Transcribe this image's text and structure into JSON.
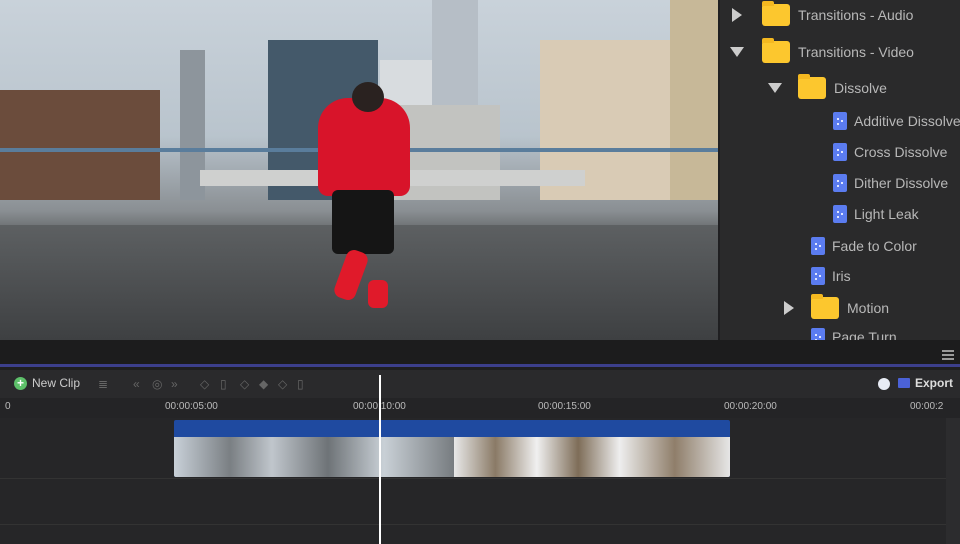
{
  "browser": {
    "items": [
      {
        "label": "Transitions - Audio",
        "type": "folder",
        "expanded": false
      },
      {
        "label": "Transitions - Video",
        "type": "folder",
        "expanded": true
      },
      {
        "label": "Dissolve",
        "type": "folder",
        "expanded": true
      },
      {
        "label": "Additive Dissolve",
        "type": "file"
      },
      {
        "label": "Cross Dissolve",
        "type": "file"
      },
      {
        "label": "Dither Dissolve",
        "type": "file"
      },
      {
        "label": "Light Leak",
        "type": "file"
      },
      {
        "label": "Fade to Color",
        "type": "file"
      },
      {
        "label": "Iris",
        "type": "file"
      },
      {
        "label": "Motion",
        "type": "folder",
        "expanded": false
      },
      {
        "label": "Page Turn",
        "type": "file"
      }
    ]
  },
  "toolbar": {
    "new_clip": "New Clip",
    "export": "Export"
  },
  "ruler": {
    "ticks": [
      "0",
      "00:00:05:00",
      "00:00:10:00",
      "00:00:15:00",
      "00:00:20:00",
      "00:00:2"
    ]
  },
  "colors": {
    "accent": "#3c3f8c",
    "clip": "#1f4aa0",
    "folder": "#fcc72e",
    "file": "#5b7cf0"
  }
}
